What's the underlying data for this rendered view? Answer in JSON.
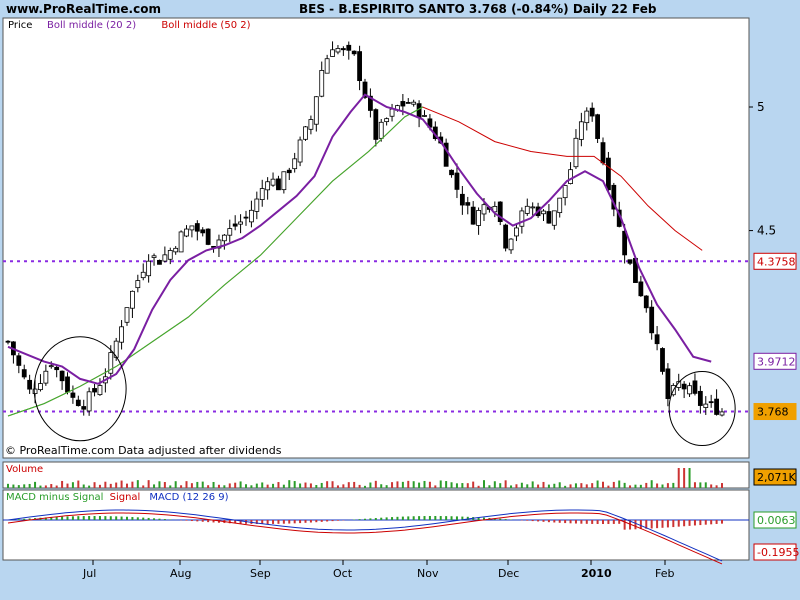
{
  "header": {
    "site": "www.ProRealTime.com",
    "title": "BES - B.ESPIRITO SANTO     3.768 (-0.84%)     Daily  22 Feb"
  },
  "price_panel": {
    "legend": [
      {
        "text": "Price",
        "color": "#000000"
      },
      {
        "text": "Boll middle (20 2)",
        "color": "#7a1fa2"
      },
      {
        "text": "Boll middle (50 2)",
        "color": "#cc0000"
      }
    ],
    "footer": "© ProRealTime.com  Data adjusted after dividends"
  },
  "volume_panel": {
    "label": "Volume",
    "value_label": "2,071K"
  },
  "macd_panel": {
    "label_parts": [
      {
        "text": "MACD minus Signal",
        "color": "#2a9d2a"
      },
      {
        "text": "Signal",
        "color": "#cc0000"
      },
      {
        "text": "MACD (12 26 9)",
        "color": "#1030c0"
      }
    ],
    "value_labels": [
      "0.0063",
      "-0.1955"
    ]
  },
  "chart_data": {
    "type": "candlestick",
    "ylim": [
      3.58,
      5.36
    ],
    "y_ticks": [
      5,
      4.5
    ],
    "x_labels": [
      "Jul",
      "Aug",
      "Sep",
      "Oct",
      "Nov",
      "Dec",
      "2010",
      "Feb"
    ],
    "price_labels": [
      {
        "value": "4.3758",
        "price": 4.3758,
        "color": "#cc0000"
      },
      {
        "value": "3.9712",
        "price": 3.9712,
        "color": "#7a1fa2"
      },
      {
        "value": "3.768",
        "price": 3.768,
        "color": "#f0a000"
      }
    ],
    "horizontal_levels": [
      4.3758,
      3.768
    ],
    "close_path": [
      [
        0,
        4.05
      ],
      [
        6,
        3.95
      ],
      [
        12,
        3.85
      ],
      [
        18,
        3.9
      ],
      [
        24,
        3.97
      ],
      [
        30,
        3.9
      ],
      [
        36,
        3.82
      ],
      [
        42,
        3.8
      ],
      [
        48,
        3.85
      ],
      [
        54,
        3.92
      ],
      [
        60,
        4.05
      ],
      [
        66,
        4.2
      ],
      [
        72,
        4.3
      ],
      [
        78,
        4.4
      ],
      [
        84,
        4.38
      ],
      [
        90,
        4.42
      ],
      [
        96,
        4.48
      ],
      [
        102,
        4.52
      ],
      [
        108,
        4.48
      ],
      [
        114,
        4.45
      ],
      [
        120,
        4.48
      ],
      [
        126,
        4.52
      ],
      [
        132,
        4.55
      ],
      [
        138,
        4.62
      ],
      [
        144,
        4.72
      ],
      [
        150,
        4.68
      ],
      [
        156,
        4.75
      ],
      [
        162,
        4.85
      ],
      [
        168,
        4.95
      ],
      [
        174,
        5.15
      ],
      [
        180,
        5.25
      ],
      [
        186,
        5.22
      ],
      [
        192,
        5.2
      ],
      [
        198,
        5.05
      ],
      [
        204,
        4.88
      ],
      [
        210,
        4.95
      ],
      [
        216,
        5.0
      ],
      [
        222,
        5.02
      ],
      [
        228,
        4.98
      ],
      [
        234,
        4.92
      ],
      [
        240,
        4.85
      ],
      [
        246,
        4.72
      ],
      [
        252,
        4.62
      ],
      [
        258,
        4.55
      ],
      [
        264,
        4.6
      ],
      [
        270,
        4.62
      ],
      [
        276,
        4.45
      ],
      [
        282,
        4.52
      ],
      [
        288,
        4.6
      ],
      [
        294,
        4.58
      ],
      [
        300,
        4.55
      ],
      [
        306,
        4.62
      ],
      [
        312,
        4.75
      ],
      [
        318,
        4.95
      ],
      [
        324,
        4.98
      ],
      [
        330,
        4.78
      ],
      [
        336,
        4.6
      ],
      [
        342,
        4.42
      ],
      [
        348,
        4.3
      ],
      [
        354,
        4.2
      ],
      [
        360,
        4.02
      ],
      [
        366,
        3.82
      ],
      [
        372,
        3.88
      ],
      [
        378,
        3.85
      ],
      [
        384,
        3.8
      ],
      [
        390,
        3.79
      ],
      [
        396,
        3.768
      ]
    ],
    "boll_middle_20": [
      [
        0,
        4.03
      ],
      [
        10,
        4.0
      ],
      [
        20,
        3.97
      ],
      [
        30,
        3.95
      ],
      [
        40,
        3.9
      ],
      [
        50,
        3.88
      ],
      [
        60,
        3.92
      ],
      [
        70,
        4.02
      ],
      [
        80,
        4.18
      ],
      [
        90,
        4.3
      ],
      [
        100,
        4.38
      ],
      [
        110,
        4.42
      ],
      [
        120,
        4.44
      ],
      [
        130,
        4.47
      ],
      [
        140,
        4.52
      ],
      [
        150,
        4.58
      ],
      [
        160,
        4.64
      ],
      [
        170,
        4.72
      ],
      [
        180,
        4.88
      ],
      [
        190,
        4.98
      ],
      [
        198,
        5.05
      ],
      [
        210,
        5.0
      ],
      [
        220,
        4.98
      ],
      [
        230,
        4.95
      ],
      [
        240,
        4.86
      ],
      [
        250,
        4.75
      ],
      [
        260,
        4.65
      ],
      [
        270,
        4.57
      ],
      [
        280,
        4.52
      ],
      [
        290,
        4.55
      ],
      [
        300,
        4.62
      ],
      [
        310,
        4.7
      ],
      [
        320,
        4.74
      ],
      [
        330,
        4.7
      ],
      [
        340,
        4.55
      ],
      [
        350,
        4.35
      ],
      [
        360,
        4.2
      ],
      [
        370,
        4.1
      ],
      [
        380,
        3.99
      ],
      [
        390,
        3.97
      ]
    ],
    "boll_middle_50": [
      [
        0,
        3.75
      ],
      [
        20,
        3.8
      ],
      [
        40,
        3.87
      ],
      [
        60,
        3.95
      ],
      [
        80,
        4.05
      ],
      [
        100,
        4.15
      ],
      [
        120,
        4.28
      ],
      [
        140,
        4.4
      ],
      [
        160,
        4.55
      ],
      [
        180,
        4.7
      ],
      [
        200,
        4.82
      ],
      [
        220,
        4.96
      ],
      [
        230,
        5.0
      ],
      [
        250,
        4.94
      ],
      [
        270,
        4.86
      ],
      [
        290,
        4.82
      ],
      [
        310,
        4.8
      ],
      [
        325,
        4.8
      ],
      [
        340,
        4.72
      ],
      [
        355,
        4.6
      ],
      [
        370,
        4.5
      ],
      [
        385,
        4.42
      ]
    ]
  }
}
